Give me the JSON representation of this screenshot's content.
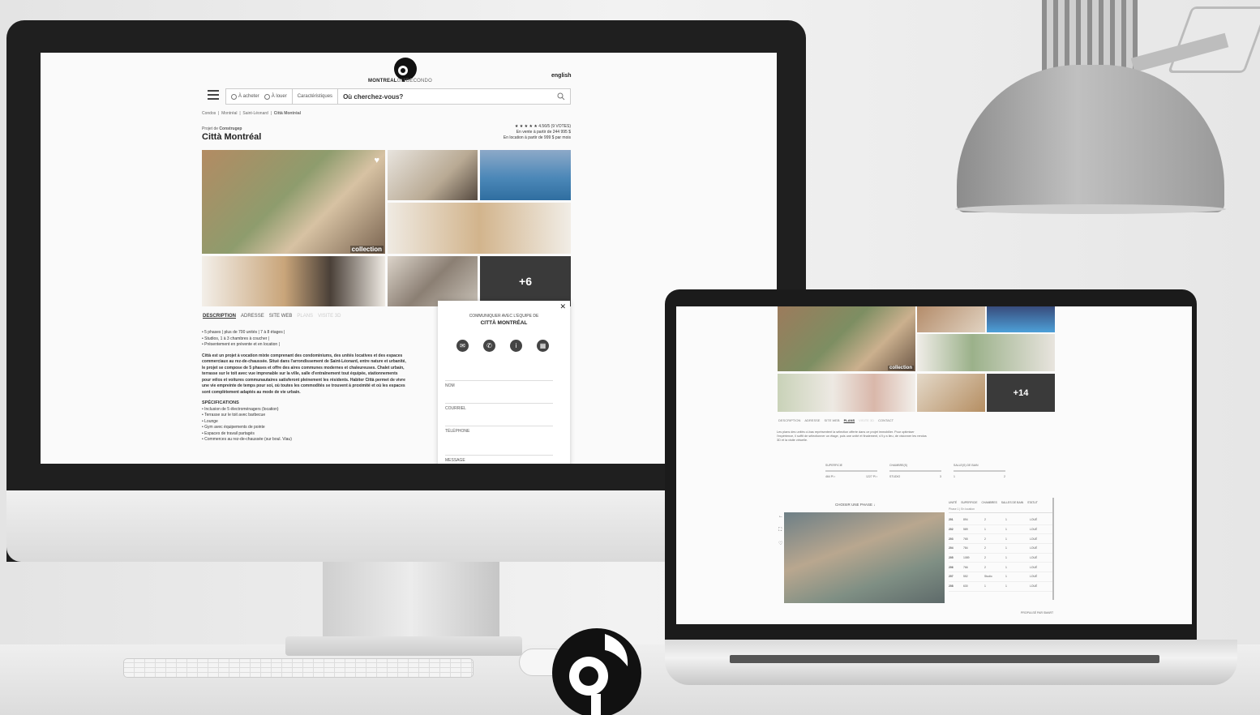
{
  "site": {
    "brand_bold": "MONTREAL",
    "brand_light": "GUIDECONDO",
    "language": "english"
  },
  "search": {
    "option_buy": "À acheter",
    "option_rent": "À louer",
    "features": "Caractéristiques",
    "query": "Où cherchez-vous?"
  },
  "breadcrumb": [
    "Condos",
    "Montréal",
    "Saint-Léonard",
    "Città Montréal"
  ],
  "project": {
    "developer_prefix": "Projet de",
    "developer": "Construgep",
    "title": "Città Montréal",
    "rating": "4.56/5 (9 VOTES)",
    "sale_line": "En vente à partir de 244 995 $",
    "rent_line": "En location à partir de 999 $ par mois",
    "gallery_badge": "collection",
    "more_photos": "+6"
  },
  "tabs": [
    "DESCRIPTION",
    "ADRESSE",
    "SITE WEB",
    "PLANS",
    "VISITE 3D"
  ],
  "description": {
    "bullets": [
      "5 phases | plus de 700 unités | 7 à 8 étages |",
      "Studios, 1 à 3 chambres à coucher |",
      "Présentement en prévente et en location |"
    ],
    "paragraph": "Città est un projet à vocation mixte comprenant des condominiums, des unités locatives et des espaces commerciaux au rez-de-chaussée. Situé dans l'arrondissement de Saint-Léonard, entre nature et urbanité, le projet se compose de 5 phases et offre des aires communes modernes et chaleureuses. Chalet urbain, terrasse sur le toit avec vue imprenable sur la ville, salle d'entraînement tout équipée, stationnements pour vélos et voitures communautaires satisferont pleinement les résidents. Habiter Città permet de vivre une vie empreinte de temps pour soi, où toutes les commodités se trouvent à proximité et où les espaces sont complètement adaptés au mode de vie urbain.",
    "spec_title": "SPÉCIFICATIONS",
    "specs": [
      "Inclusion de 5 électroménagers (location)",
      "Terrasse sur le toit avec barbecue",
      "Lounge",
      "Gym avec équipements de pointe",
      "Espaces de travail partagés",
      "Commerces au rez-de-chaussée (sur boul. Viau)"
    ]
  },
  "contact_form": {
    "heading": "COMMUNIQUER AVEC L'ÉQUIPE DE",
    "project_name": "CITTÀ MONTRÉAL",
    "fields": [
      "NOM",
      "COURRIEL",
      "TÉLÉPHONE",
      "MESSAGE"
    ]
  },
  "laptop": {
    "more_photos": "+14",
    "gallery_badge": "collection",
    "tabs": [
      "DESCRIPTION",
      "ADRESSE",
      "SITE WEB",
      "PLANS",
      "VISITE 3D",
      "CONTACT"
    ],
    "plans_text": "Les plans des unités ci-bas représentent la sélection offerte dans ce projet immobilier. Pour optimiser l'expérience, il suffit de sélectionner un étage, puis une unité et finalement, s'il y a lieu, de visionner les rendus 3D et la visite virtuelle.",
    "filters": [
      {
        "label": "SUPERFICIE",
        "min": "464 Pi ²",
        "max": "1227 Pi ²"
      },
      {
        "label": "CHAMBRE(S)",
        "min": "STUDIO",
        "max": "3"
      },
      {
        "label": "SALLE(S) DE BAIN",
        "min": "1",
        "max": "2"
      }
    ],
    "choose_phase": "CHOISIR UNE PHASE",
    "table_headers": [
      "UNITÉ",
      "SUPERFICIE",
      "CHAMBRES",
      "SALLES DE BAIN",
      "STATUT"
    ],
    "phase_select": "Phase 1 | En location",
    "rows": [
      [
        "201",
        "894",
        "2",
        "1",
        "LOUÉ"
      ],
      [
        "202",
        "589",
        "1",
        "1",
        "LOUÉ"
      ],
      [
        "203",
        "765",
        "2",
        "1",
        "LOUÉ"
      ],
      [
        "204",
        "784",
        "2",
        "1",
        "LOUÉ"
      ],
      [
        "205",
        "1089",
        "2",
        "1",
        "LOUÉ"
      ],
      [
        "206",
        "766",
        "2",
        "1",
        "LOUÉ"
      ],
      [
        "207",
        "552",
        "Studio",
        "1",
        "LOUÉ"
      ],
      [
        "208",
        "630",
        "1",
        "1",
        "LOUÉ"
      ]
    ],
    "footer": "PROPULSÉ PAR SMART"
  },
  "colors": {
    "screen_bg": "#fafafa",
    "bezel": "#1f1f1f",
    "accent_dark": "#3a3a3a"
  }
}
